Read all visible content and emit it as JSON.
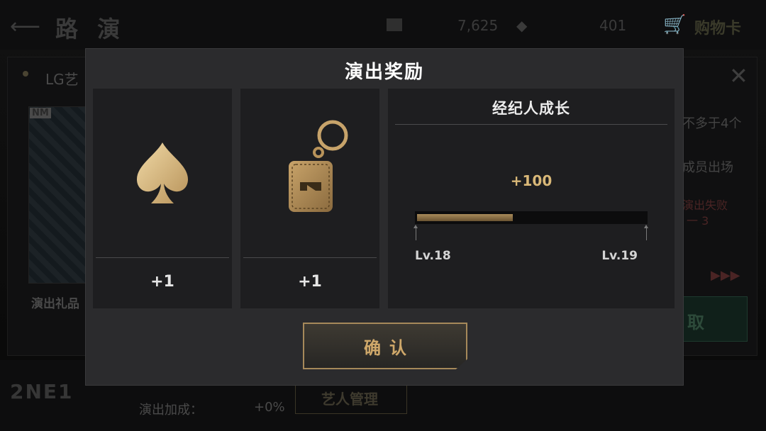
{
  "background": {
    "page_title": "路 演",
    "currency_1": "7,625",
    "currency_2": "401",
    "shop_label": "购物卡",
    "mission_title": "LG艺",
    "card_badge": "NM",
    "gift_label": "演出礼品",
    "side_texts": [
      "不多于4个",
      "成员出场",
      "演出失败",
      "一 3",
      "▶▶▶"
    ],
    "side_button": "取",
    "logo": "2NE1",
    "bonus_label": "演出加成：",
    "bonus_value": "+0%",
    "mgmt_button": "艺人管理"
  },
  "modal": {
    "title": "演出奖励",
    "rewards": [
      {
        "icon": "spade-icon",
        "amount": "+1"
      },
      {
        "icon": "keychain-icon",
        "amount": "+1"
      }
    ],
    "growth": {
      "title": "经纪人成长",
      "exp_gain": "+100",
      "progress": 0.42,
      "level_from": "Lv.18",
      "level_to": "Lv.19"
    },
    "confirm_label": "确认"
  },
  "colors": {
    "gold": "#d9b878",
    "button_border": "#a6895a",
    "modal_bg": "#2b2b2d",
    "tile_bg": "#1e1e20"
  }
}
